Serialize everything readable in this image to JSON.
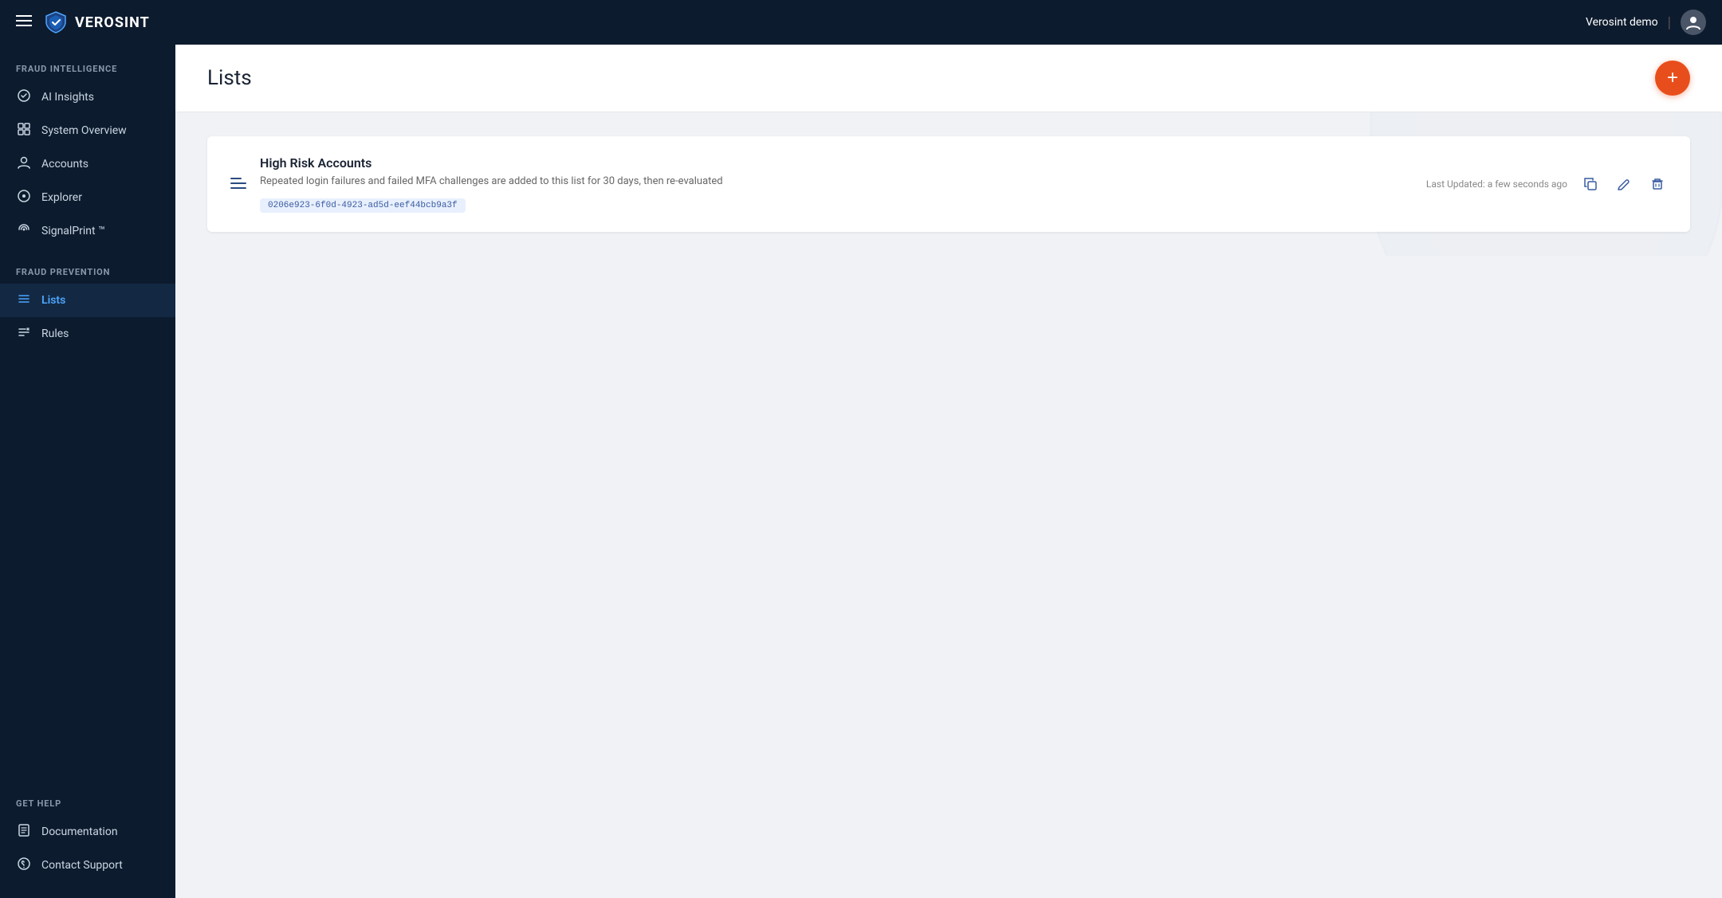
{
  "app": {
    "name": "VEROSINT",
    "user": "Verosint demo"
  },
  "nav": {
    "hamburger_label": "≡",
    "user_icon": "person"
  },
  "sidebar": {
    "fraud_intelligence_label": "FRAUD INTELLIGENCE",
    "fraud_prevention_label": "FRAUD PREVENTION",
    "get_help_label": "GET HELP",
    "items": [
      {
        "id": "ai-insights",
        "label": "AI Insights",
        "icon": "ai"
      },
      {
        "id": "system-overview",
        "label": "System Overview",
        "icon": "grid"
      },
      {
        "id": "accounts",
        "label": "Accounts",
        "icon": "person"
      },
      {
        "id": "explorer",
        "label": "Explorer",
        "icon": "circle"
      },
      {
        "id": "signalprint",
        "label": "SignalPrint ™",
        "icon": "signal"
      },
      {
        "id": "lists",
        "label": "Lists",
        "icon": "list",
        "active": true
      },
      {
        "id": "rules",
        "label": "Rules",
        "icon": "rules"
      }
    ],
    "help_items": [
      {
        "id": "documentation",
        "label": "Documentation",
        "icon": "doc"
      },
      {
        "id": "contact-support",
        "label": "Contact Support",
        "icon": "help"
      }
    ]
  },
  "page": {
    "title": "Lists",
    "add_button_label": "+"
  },
  "lists": [
    {
      "id": "list-1",
      "title": "High Risk Accounts",
      "description": "Repeated login failures and failed MFA challenges are added to this list for 30 days, then re-evaluated",
      "uuid": "0206e923-6f0d-4923-ad5d-eef44bcb9a3f",
      "last_updated": "Last Updated: a few seconds ago"
    }
  ]
}
